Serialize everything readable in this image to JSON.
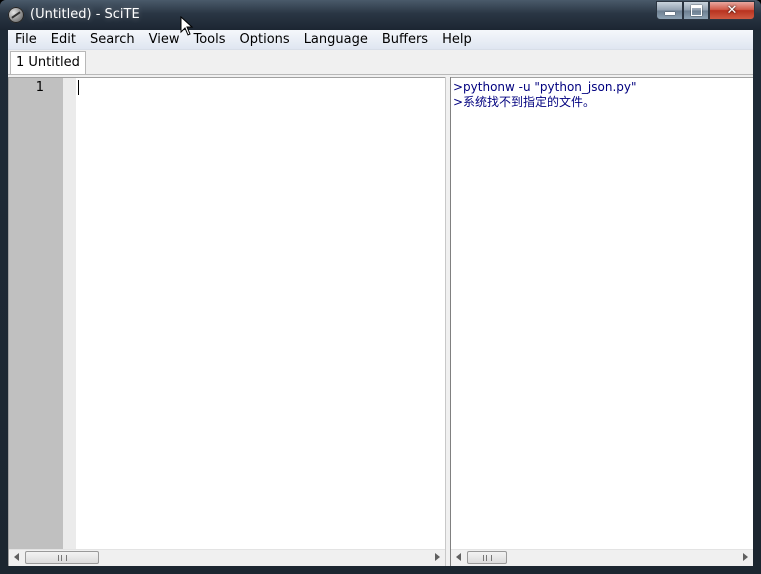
{
  "window": {
    "title": "(Untitled) - SciTE",
    "icon": "scite-app-icon",
    "controls": {
      "minimize": "minimize-icon",
      "maximize": "maximize-icon",
      "close": "close-icon"
    }
  },
  "menu": {
    "items": [
      "File",
      "Edit",
      "Search",
      "View",
      "Tools",
      "Options",
      "Language",
      "Buffers",
      "Help"
    ]
  },
  "tabs": [
    {
      "label": "1 Untitled",
      "active": true
    }
  ],
  "editor": {
    "line_numbers": [
      "1"
    ],
    "content": ""
  },
  "output": {
    "lines": [
      ">pythonw -u \"python_json.py\"",
      ">系统找不到指定的文件。"
    ],
    "color": "#00007f"
  },
  "colors": {
    "gutter": "#c0c0c0",
    "fold_margin": "#ebebeb",
    "output_text": "#00007f"
  }
}
